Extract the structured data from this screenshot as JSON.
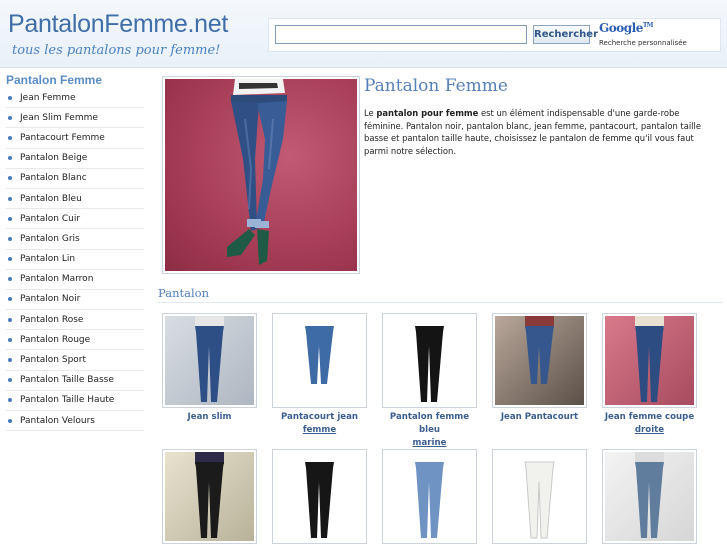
{
  "site": {
    "logo": "PantalonFemme.net",
    "tagline": "tous les pantalons pour femme!"
  },
  "search": {
    "placeholder": "",
    "button_label": "Rechercher",
    "google_logo": "Google",
    "google_tm": "TM",
    "google_subtitle": "Recherche personnalisée"
  },
  "sidebar": {
    "title": "Pantalon Femme",
    "items": [
      {
        "label": "Jean Femme"
      },
      {
        "label": "Jean Slim Femme"
      },
      {
        "label": "Pantacourt Femme"
      },
      {
        "label": "Pantalon Beige"
      },
      {
        "label": "Pantalon Blanc"
      },
      {
        "label": "Pantalon Bleu"
      },
      {
        "label": "Pantalon Cuir"
      },
      {
        "label": "Pantalon Gris"
      },
      {
        "label": "Pantalon Lin"
      },
      {
        "label": "Pantalon Marron"
      },
      {
        "label": "Pantalon Noir"
      },
      {
        "label": "Pantalon Rose"
      },
      {
        "label": "Pantalon Rouge"
      },
      {
        "label": "Pantalon Sport"
      },
      {
        "label": "Pantalon Taille Basse"
      },
      {
        "label": "Pantalon Taille Haute"
      },
      {
        "label": "Pantalon Velours"
      }
    ]
  },
  "main": {
    "title": "Pantalon Femme",
    "intro_prefix": "Le ",
    "intro_bold": "pantalon pour femme",
    "intro_rest": " est un élément indispensable d'une garde-robe féminine. Pantalon noir, pantalon blanc, jean femme, pantacourt, pantalon taille basse et pantalon taille haute, choisissez le pantalon de femme qu'il vous faut parmi notre sélection.",
    "section_title": "Pantalon",
    "products": [
      {
        "line1": "Jean slim",
        "line2": "",
        "icon": "jean-slim-photo"
      },
      {
        "line1": "Pantacourt jean",
        "line2": "femme",
        "icon": "pantacourt-photo"
      },
      {
        "line1": "Pantalon femme bleu",
        "line2": "marine",
        "icon": "black-pants-photo"
      },
      {
        "line1": "Jean Pantacourt",
        "line2": "",
        "icon": "jean-pantacourt-photo"
      },
      {
        "line1": "Jean femme coupe",
        "line2": "droite",
        "icon": "jean-droite-photo"
      },
      {
        "line1": "",
        "line2": "",
        "icon": "black-skinny-photo"
      },
      {
        "line1": "",
        "line2": "",
        "icon": "black-pants-2-photo"
      },
      {
        "line1": "",
        "line2": "",
        "icon": "light-jean-photo"
      },
      {
        "line1": "",
        "line2": "",
        "icon": "white-pants-photo"
      },
      {
        "line1": "",
        "line2": "",
        "icon": "grey-jean-photo"
      }
    ]
  },
  "colors": {
    "accent": "#5580b8",
    "brand": "#3f6ea8",
    "link": "#3c5f8f"
  }
}
